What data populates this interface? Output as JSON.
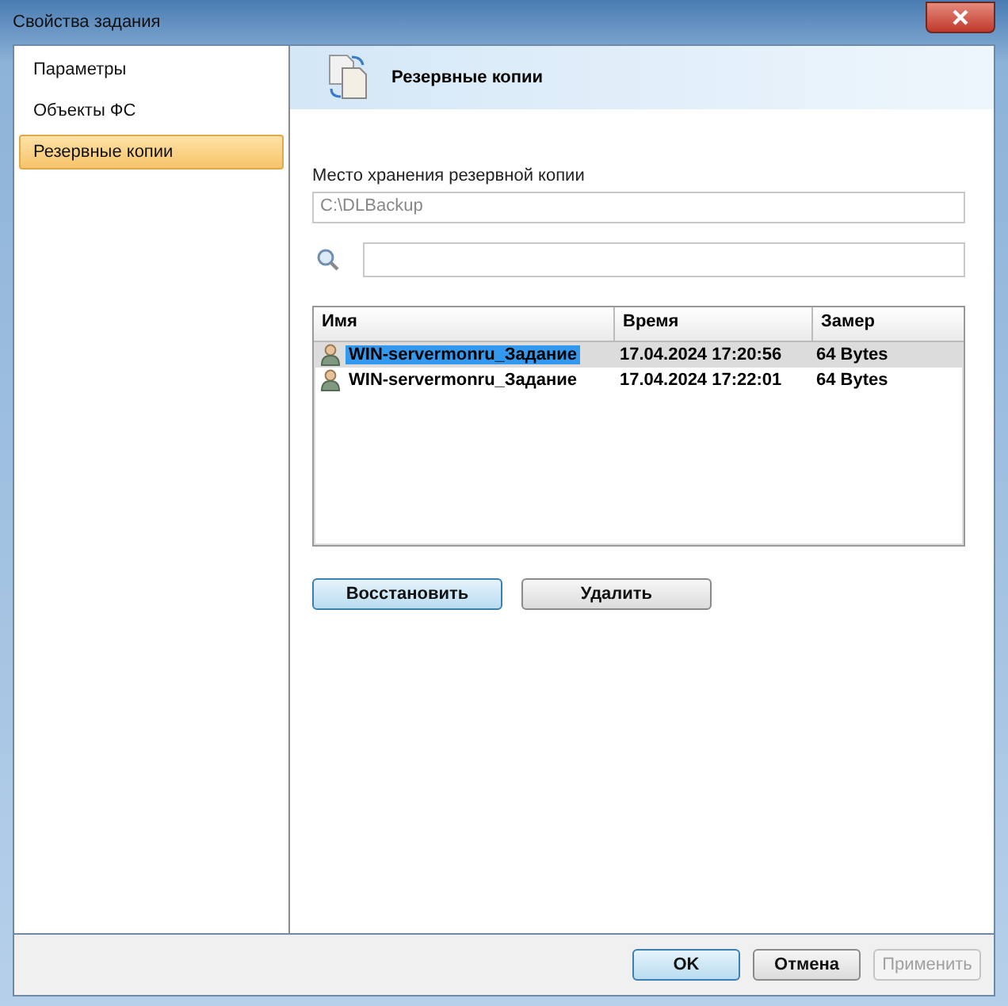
{
  "window": {
    "title": "Свойства задания"
  },
  "sidebar": {
    "items": [
      {
        "label": "Параметры",
        "selected": false
      },
      {
        "label": "Объекты ФС",
        "selected": false
      },
      {
        "label": "Резервные копии",
        "selected": true
      }
    ]
  },
  "header": {
    "title": "Резервные копии"
  },
  "storage": {
    "label": "Место хранения резервной копии",
    "value": "C:\\DLBackup"
  },
  "table": {
    "columns": [
      "Имя",
      "Время",
      "Замер"
    ],
    "rows": [
      {
        "cells": [
          "WIN-servermonru_Задание",
          "17.04.2024 17:20:56",
          "64 Bytes"
        ],
        "selected": true
      },
      {
        "cells": [
          "WIN-servermonru_Задание",
          "17.04.2024 17:22:01",
          "64 Bytes"
        ],
        "selected": false
      }
    ]
  },
  "actions": [
    {
      "label": "Восстановить",
      "default": true
    },
    {
      "label": "Удалить",
      "default": false
    }
  ],
  "buttons": [
    {
      "label": "OK",
      "default": true,
      "disabled": false
    },
    {
      "label": "Отмена",
      "default": false,
      "disabled": false
    },
    {
      "label": "Применить",
      "default": false,
      "disabled": true
    }
  ]
}
